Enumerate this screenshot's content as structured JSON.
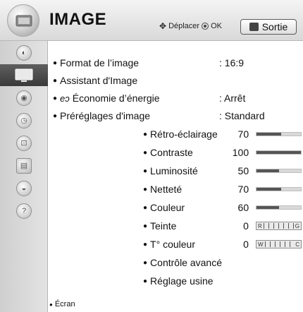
{
  "header": {
    "title": "IMAGE",
    "nav_hint": "Déplacer",
    "ok_label": "OK",
    "exit_label": "Sortie",
    "icon": "picture-menu-icon"
  },
  "sidebar": {
    "items": [
      {
        "icon": "picture-menu-icon",
        "active": false
      },
      {
        "icon": "monitor-icon",
        "active": true
      },
      {
        "icon": "speaker-icon",
        "active": false
      },
      {
        "icon": "clock-icon",
        "active": false
      },
      {
        "icon": "lock-icon",
        "active": false
      },
      {
        "icon": "options-icon",
        "active": false
      },
      {
        "icon": "network-icon",
        "active": false
      },
      {
        "icon": "help-icon",
        "active": false
      }
    ]
  },
  "menu": {
    "items": [
      {
        "label": "Format de l’image",
        "value": ": 16:9"
      },
      {
        "label": "Assistant d'Image",
        "value": ""
      },
      {
        "label": "Économie d’énergie",
        "value": ": Arrêt",
        "icon": "leaf-icon"
      },
      {
        "label": "Préréglages d'image",
        "value": ": Standard"
      }
    ],
    "sub_items": [
      {
        "label": "Rétro-éclairage",
        "value": "70",
        "level": 0.55
      },
      {
        "label": "Contraste",
        "value": "100",
        "level": 1.0
      },
      {
        "label": "Luminosité",
        "value": "50",
        "level": 0.5
      },
      {
        "label": "Netteté",
        "value": "70",
        "level": 0.55
      },
      {
        "label": "Couleur",
        "value": "60",
        "level": 0.5
      },
      {
        "label": "Teinte",
        "value": "0",
        "scale_left": "R",
        "scale_right": "G"
      },
      {
        "label": "T° couleur",
        "value": "0",
        "scale_left": "W",
        "scale_right": "C"
      },
      {
        "label": "Contrôle avancé"
      },
      {
        "label": "Réglage usine"
      }
    ]
  },
  "footer": {
    "label": "Écran"
  },
  "colors": {
    "accent": "#444444",
    "bar_fill": "#555555",
    "sidebar_active": "#4a4a4a"
  }
}
